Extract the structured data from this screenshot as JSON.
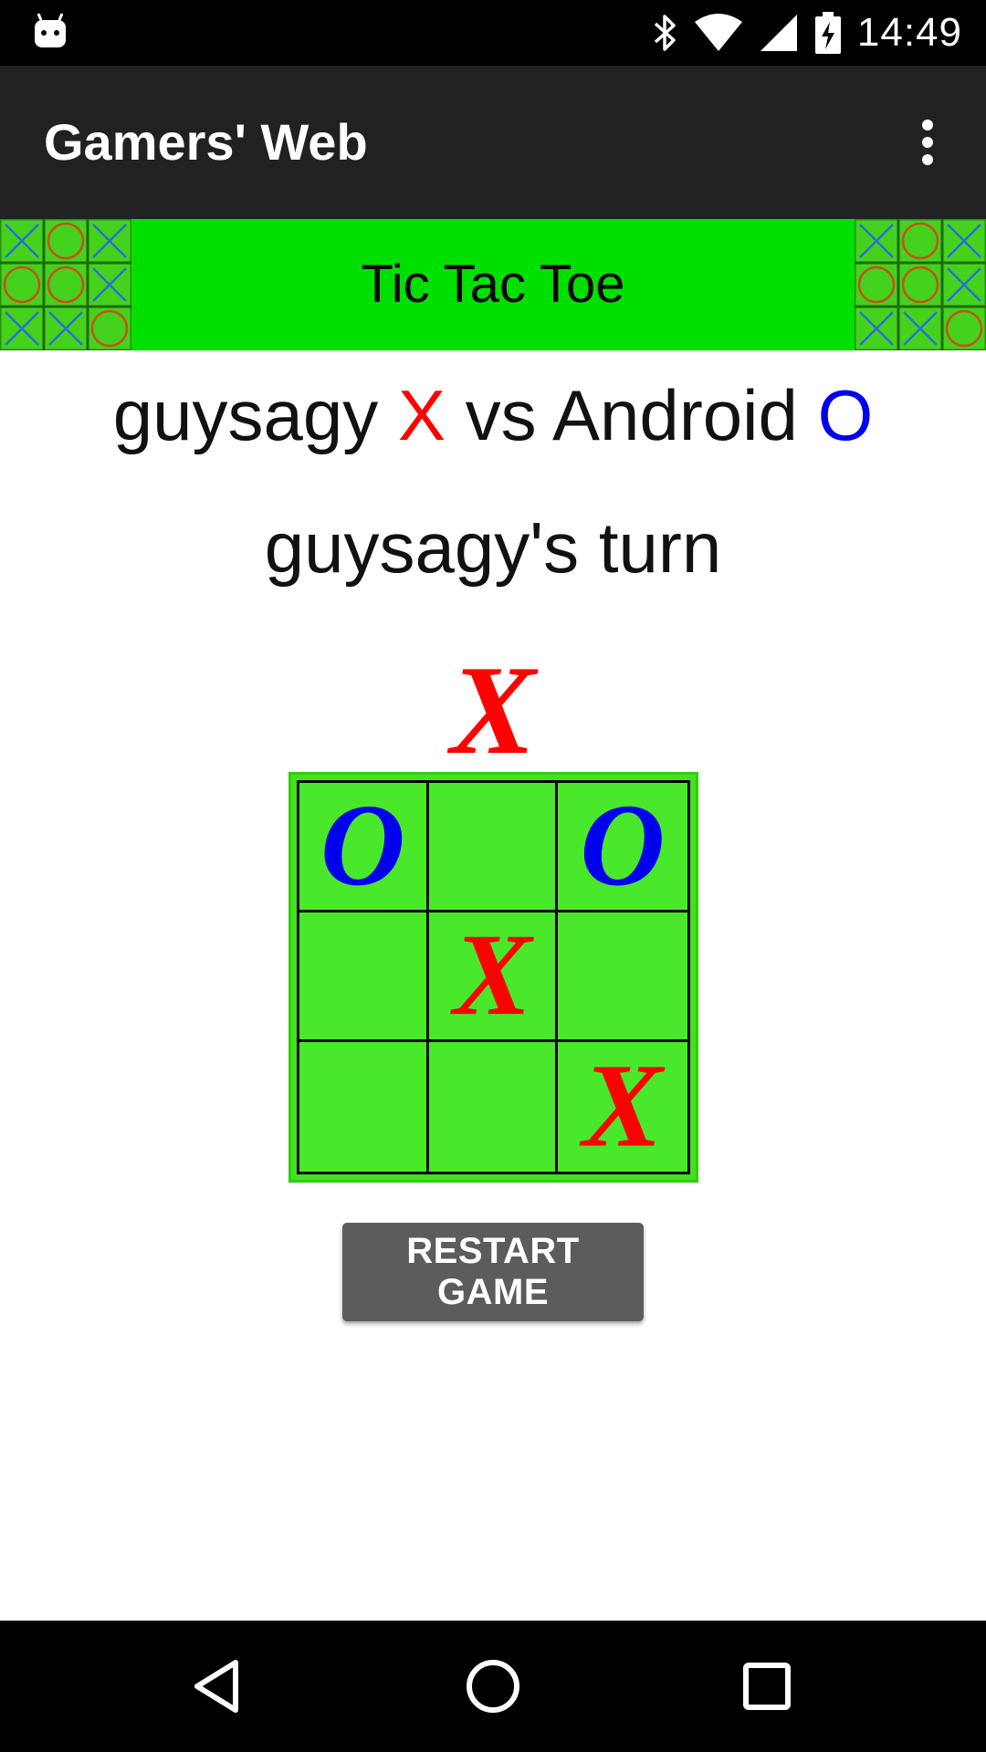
{
  "status_bar": {
    "time": "14:49",
    "icons": [
      "android-debug-icon",
      "bluetooth-icon",
      "wifi-icon",
      "cellular-signal-icon",
      "battery-charging-icon"
    ]
  },
  "app_bar": {
    "title": "Gamers' Web",
    "overflow_icon": "more-vert-icon"
  },
  "banner": {
    "title": "Tic Tac Toe",
    "thumbnail_icon": "tic-tac-toe-icon"
  },
  "match": {
    "player1": "guysagy",
    "player1_mark": "X",
    "versus": "vs",
    "player2": "Android",
    "player2_mark": "O",
    "turn_text": "guysagy's turn",
    "next_mark": "X"
  },
  "board": {
    "cells": [
      [
        "O",
        "",
        "O"
      ],
      [
        "",
        "X",
        ""
      ],
      [
        "",
        "",
        "X"
      ]
    ],
    "colors": {
      "x": "#ff0000",
      "o": "#0000ee",
      "cell": "#4ae82a"
    }
  },
  "actions": {
    "restart_label": "RESTART GAME"
  },
  "nav_bar": {
    "icons": [
      "back-icon",
      "home-icon",
      "recents-icon"
    ]
  }
}
